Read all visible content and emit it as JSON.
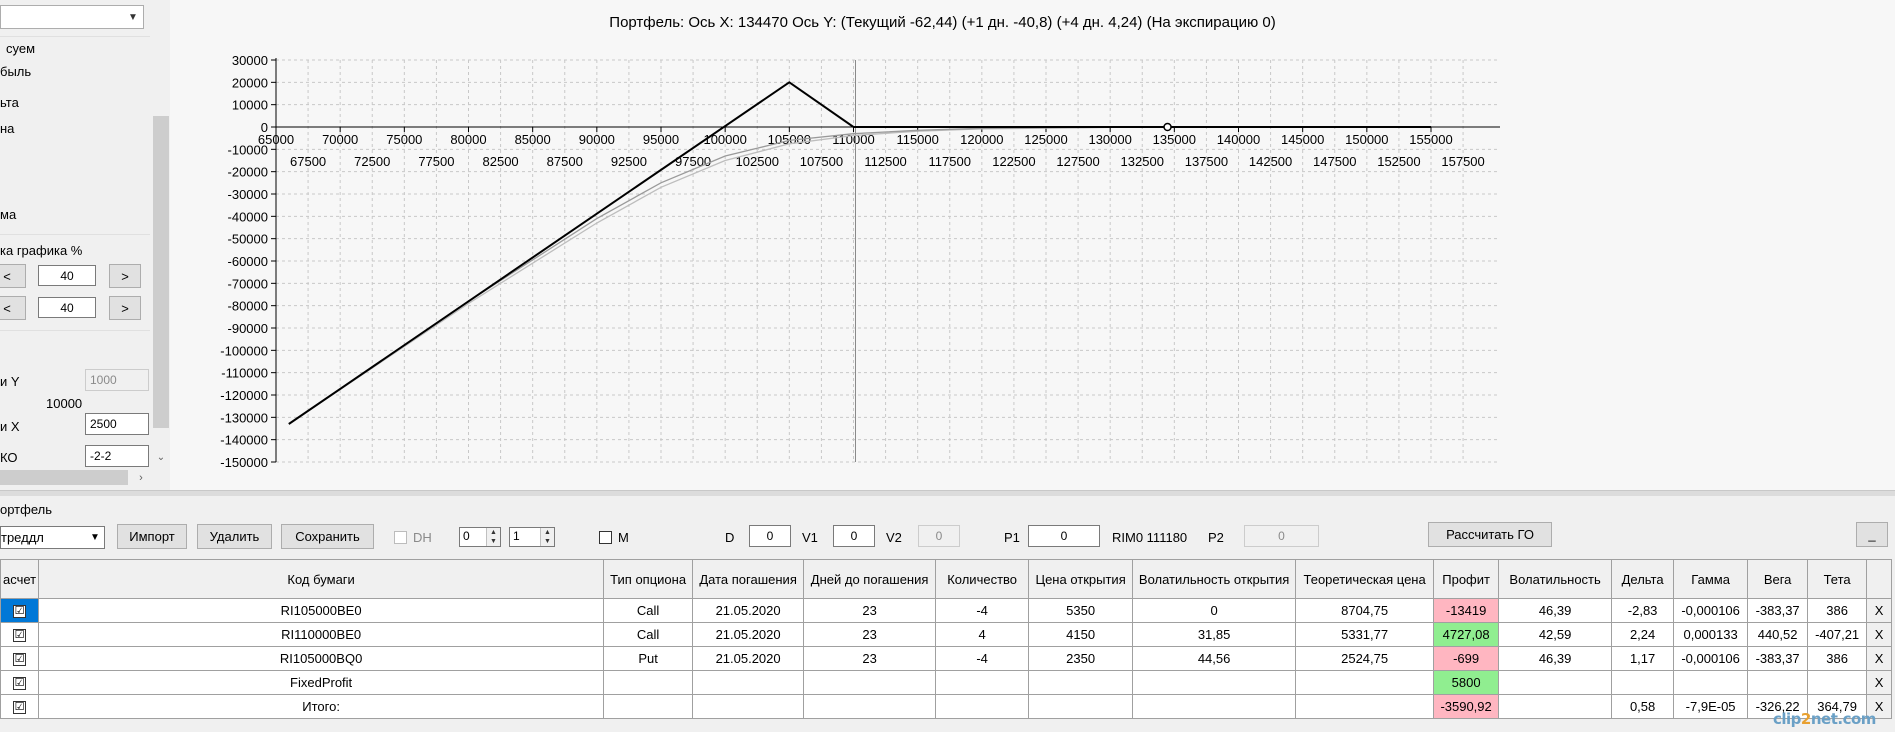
{
  "left_panel": {
    "labels": [
      {
        "text": "суем",
        "x": 6,
        "y": 42
      },
      {
        "text": "быль",
        "x": 0,
        "y": 65
      },
      {
        "text": "ьта",
        "x": 0,
        "y": 95
      },
      {
        "text": "на",
        "x": 0,
        "y": 122
      },
      {
        "text": "ма",
        "x": 0,
        "y": 208
      },
      {
        "text": "ка графика %",
        "x": 0,
        "y": 243
      }
    ],
    "scale_rows": [
      {
        "left": "<",
        "value": "40",
        "right": ">"
      },
      {
        "left": "<",
        "value": "40",
        "right": ">"
      }
    ],
    "step_y_label": "и Y",
    "step_y_value": "1000",
    "center_value": "10000",
    "step_x_label": "и X",
    "step_x_value": "2500",
    "ko_label": "КО",
    "ko_value": "-2-2"
  },
  "chart_title": "Портфель: Ось X: 134470 Ось Y:  (Текущий -62,44)  (+1 дн. -40,8)  (+4 дн. 4,24)  (На экспирацию 0)",
  "chart_data": {
    "type": "line",
    "x_ticks_upper": [
      65000,
      70000,
      75000,
      80000,
      85000,
      90000,
      95000,
      100000,
      105000,
      110000,
      115000,
      120000,
      125000,
      130000,
      135000,
      140000,
      145000,
      150000,
      155000
    ],
    "x_ticks_lower": [
      67500,
      72500,
      77500,
      82500,
      87500,
      92500,
      97500,
      102500,
      107500,
      112500,
      117500,
      122500,
      127500,
      132500,
      137500,
      142500,
      147500,
      152500,
      157500
    ],
    "y_ticks": [
      30000,
      20000,
      10000,
      0,
      -10000,
      -20000,
      -30000,
      -40000,
      -50000,
      -60000,
      -70000,
      -80000,
      -90000,
      -100000,
      -110000,
      -120000,
      -130000,
      -140000,
      -150000
    ],
    "xlim": [
      65000,
      155000
    ],
    "ylim": [
      -150000,
      30000
    ],
    "cursor_x": 110000,
    "marker": {
      "x": 134470,
      "y": 0
    },
    "series": [
      {
        "color": "#000000",
        "points": [
          [
            66000,
            -133000
          ],
          [
            105000,
            20000
          ],
          [
            110000,
            0
          ],
          [
            155000,
            0
          ]
        ]
      },
      {
        "color": "#9a9a9a",
        "points": [
          [
            66000,
            -133000
          ],
          [
            80000,
            -78000
          ],
          [
            90000,
            -41000
          ],
          [
            95000,
            -25000
          ],
          [
            100000,
            -13000
          ],
          [
            105000,
            -6000
          ],
          [
            110000,
            -3000
          ],
          [
            115000,
            -1500
          ],
          [
            120000,
            -600
          ],
          [
            130000,
            -150
          ],
          [
            140000,
            0
          ],
          [
            155000,
            0
          ]
        ]
      },
      {
        "color": "#bdbdbd",
        "points": [
          [
            66000,
            -133000
          ],
          [
            80000,
            -79000
          ],
          [
            90000,
            -43000
          ],
          [
            95000,
            -27000
          ],
          [
            100000,
            -15000
          ],
          [
            105000,
            -7500
          ],
          [
            110000,
            -3800
          ],
          [
            115000,
            -1900
          ],
          [
            120000,
            -800
          ],
          [
            130000,
            -200
          ],
          [
            140000,
            0
          ],
          [
            155000,
            0
          ]
        ]
      }
    ]
  },
  "portfolio": {
    "legend": "ортфель",
    "combo_value": "треддл",
    "buttons": {
      "import": "Импорт",
      "delete": "Удалить",
      "save": "Сохранить",
      "calc": "Рассчитать ГО",
      "minimize": "_"
    },
    "dh_label": "DH",
    "spin1": "0",
    "spin2": "1",
    "m_label": "M",
    "d_label": "D",
    "d_value": "0",
    "v1_label": "V1",
    "v1_value": "0",
    "v2_label": "V2",
    "v2_value": "0",
    "p1_label": "P1",
    "p1_value": "0",
    "rim_label": "RIM0 111180",
    "p2_label": "P2",
    "p2_value": "0"
  },
  "grid": {
    "columns": [
      "асчет",
      "Код бумаги",
      "Тип опциона",
      "Дата погашения",
      "Дней до погашения",
      "Количество",
      "Цена открытия",
      "Волатильность открытия",
      "Теоретическая цена",
      "Профит",
      "Волатильность",
      "Дельта",
      "Гамма",
      "Вега",
      "Тета",
      ""
    ],
    "rows": [
      {
        "check": "☑",
        "code": "RI105000BE0",
        "type": "Call",
        "date": "21.05.2020",
        "days": "23",
        "qty": "-4",
        "open_price": "5350",
        "open_vol": "0",
        "theo": "8704,75",
        "profit": "-13419",
        "profit_color": "red",
        "vol": "46,39",
        "delta": "-2,83",
        "gamma": "-0,000106",
        "vega": "-383,37",
        "theta": "386",
        "x": "X",
        "selected": true
      },
      {
        "check": "☑",
        "code": "RI110000BE0",
        "type": "Call",
        "date": "21.05.2020",
        "days": "23",
        "qty": "4",
        "open_price": "4150",
        "open_vol": "31,85",
        "theo": "5331,77",
        "profit": "4727,08",
        "profit_color": "green",
        "vol": "42,59",
        "delta": "2,24",
        "gamma": "0,000133",
        "vega": "440,52",
        "theta": "-407,21",
        "x": "X"
      },
      {
        "check": "☑",
        "code": "RI105000BQ0",
        "type": "Put",
        "date": "21.05.2020",
        "days": "23",
        "qty": "-4",
        "open_price": "2350",
        "open_vol": "44,56",
        "theo": "2524,75",
        "profit": "-699",
        "profit_color": "red",
        "vol": "46,39",
        "delta": "1,17",
        "gamma": "-0,000106",
        "vega": "-383,37",
        "theta": "386",
        "x": "X"
      },
      {
        "check": "☑",
        "code": "FixedProfit",
        "type": "",
        "date": "",
        "days": "",
        "qty": "",
        "open_price": "",
        "open_vol": "",
        "theo": "",
        "profit": "5800",
        "profit_color": "green",
        "vol": "",
        "delta": "",
        "gamma": "",
        "vega": "",
        "theta": "",
        "x": "X"
      },
      {
        "check": "☑",
        "code": "Итого:",
        "type": "",
        "date": "",
        "days": "",
        "qty": "",
        "open_price": "",
        "open_vol": "",
        "theo": "",
        "profit": "-3590,92",
        "profit_color": "red",
        "vol": "",
        "delta": "0,58",
        "gamma": "-7,9E-05",
        "vega": "-326,22",
        "theta": "364,79",
        "x": "X"
      }
    ]
  },
  "watermark": {
    "a": "clip",
    "b": "2",
    "c": "net.com"
  }
}
